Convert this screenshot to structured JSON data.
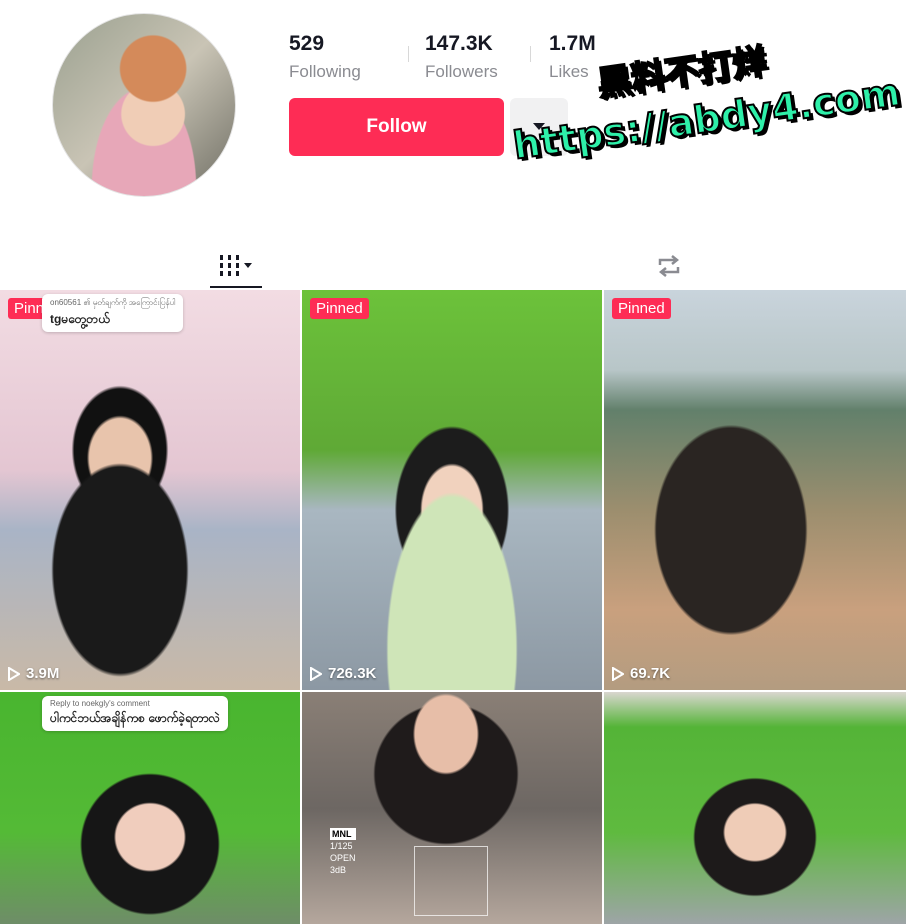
{
  "profile": {
    "stats": [
      {
        "value": "529",
        "label": "Following"
      },
      {
        "value": "147.3K",
        "label": "Followers"
      },
      {
        "value": "1.7M",
        "label": "Likes"
      }
    ],
    "follow_label": "Follow"
  },
  "watermark": {
    "line1": "黑料不打烊",
    "line2": "https://abdy4.com"
  },
  "tabs": {
    "videos_icon": "grid-icon",
    "reposts_icon": "repost-icon"
  },
  "videos": [
    {
      "pinned": "Pinned",
      "views": "3.9M",
      "comment_meta": "on60561 ၏ မှတ်ချက်ကို အကြောင်းပြန်ပါ",
      "comment_text": "tgမတွေ့တယ်"
    },
    {
      "pinned": "Pinned",
      "views": "726.3K"
    },
    {
      "pinned": "Pinned",
      "views": "69.7K"
    },
    {
      "comment_meta": "Reply to noekgly's comment",
      "comment_text": "ပါကင်ဘယ်အချိန်ကစ ဖောက်ခဲ့ရတာလဲ"
    },
    {
      "overlay_lines": [
        "MNL",
        "1/125",
        "OPEN",
        "3dB"
      ]
    },
    {}
  ],
  "colors": {
    "accent": "#fe2c55",
    "watermark_green": "#2ef0a9"
  }
}
